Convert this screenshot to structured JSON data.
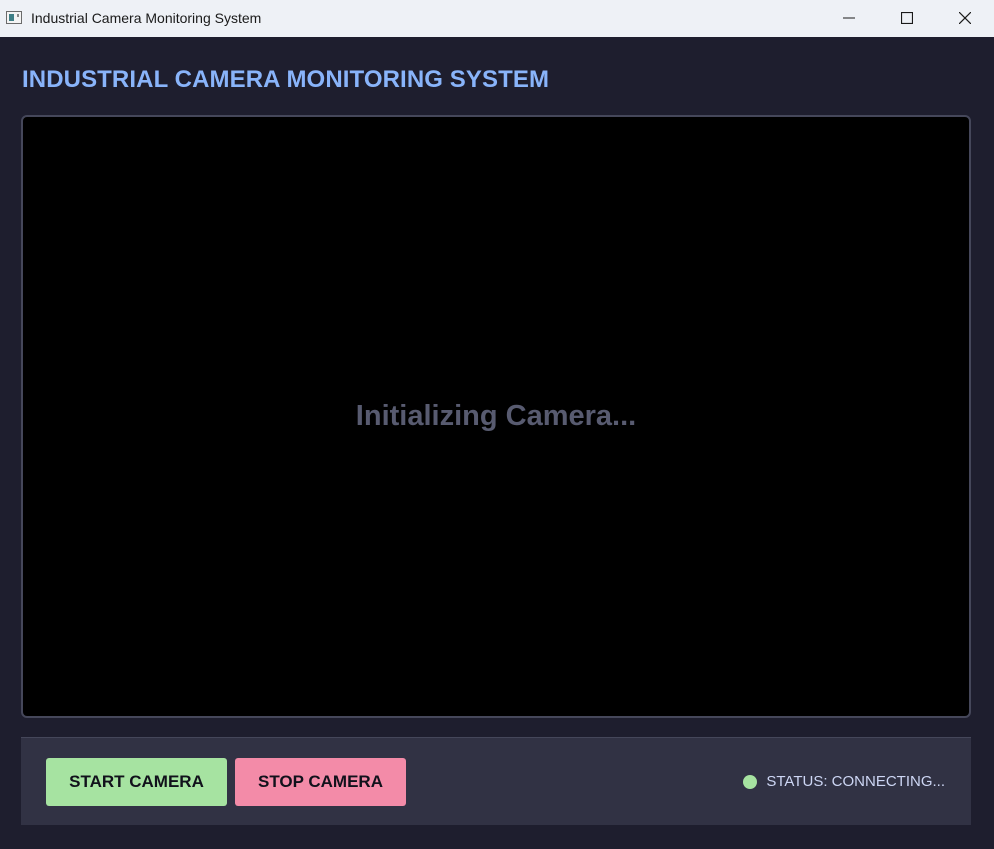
{
  "window": {
    "title": "Industrial Camera Monitoring System",
    "controls": {
      "minimize": "minimize-icon",
      "maximize": "maximize-icon",
      "close": "close-icon"
    }
  },
  "header": {
    "title": "INDUSTRIAL CAMERA MONITORING SYSTEM"
  },
  "camera": {
    "message": "Initializing Camera..."
  },
  "controls": {
    "start_label": "START CAMERA",
    "stop_label": "STOP CAMERA"
  },
  "status": {
    "text": "STATUS: CONNECTING...",
    "indicator_color": "#a6e3a1"
  },
  "colors": {
    "accent": "#89b4fa",
    "start_button": "#a6e3a1",
    "stop_button": "#f38ba8",
    "background": "#1e1e2e",
    "panel": "#313244"
  }
}
